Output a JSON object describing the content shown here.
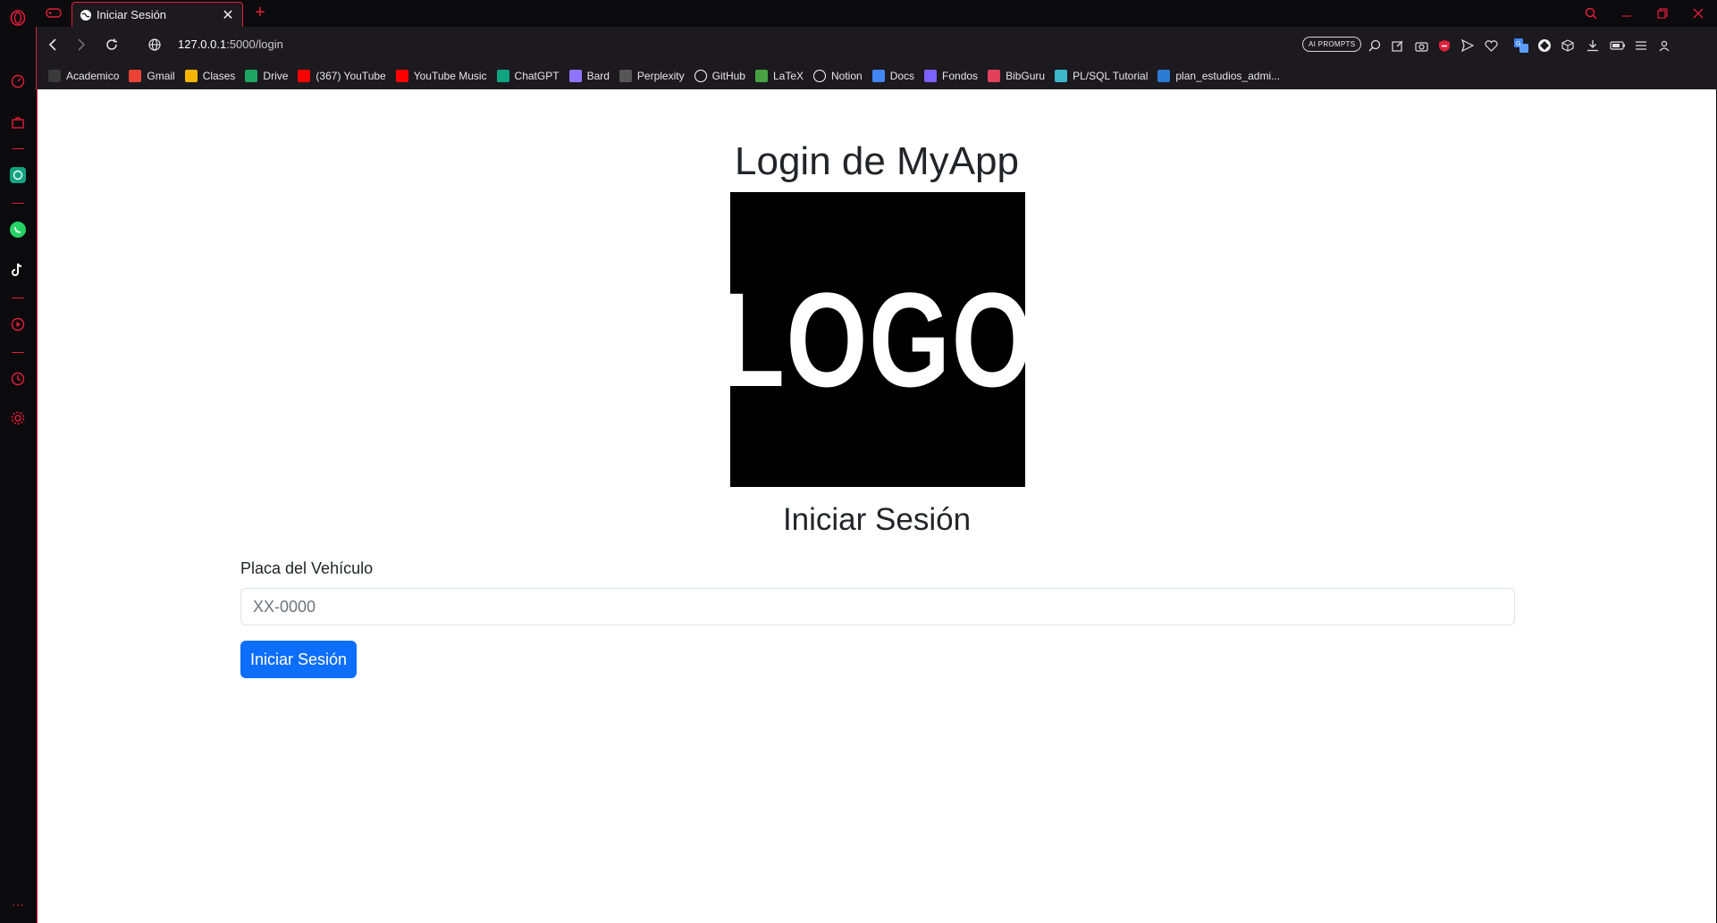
{
  "tab": {
    "title": "Iniciar Sesión",
    "new_tab": "+",
    "close": "✕"
  },
  "address": {
    "host": "127.0.0.1",
    "path": ":5000/login"
  },
  "toolbar": {
    "ai_prompts": "AI PROMPTS"
  },
  "bookmarks": [
    {
      "label": "Academico",
      "icon": "star-icon",
      "color": "#3a3a3a"
    },
    {
      "label": "Gmail",
      "icon": "gmail-icon",
      "color": "#ea4335"
    },
    {
      "label": "Clases",
      "icon": "classroom-icon",
      "color": "#f4b400"
    },
    {
      "label": "Drive",
      "icon": "drive-icon",
      "color": "#1fa463"
    },
    {
      "label": "(367) YouTube",
      "icon": "youtube-icon",
      "color": "#ff0000"
    },
    {
      "label": "YouTube Music",
      "icon": "youtube-music-icon",
      "color": "#ff0000"
    },
    {
      "label": "ChatGPT",
      "icon": "chatgpt-icon",
      "color": "#10a37f"
    },
    {
      "label": "Bard",
      "icon": "bard-icon",
      "color": "#8e75ff"
    },
    {
      "label": "Perplexity",
      "icon": "perplexity-icon",
      "color": "#555555"
    },
    {
      "label": "GitHub",
      "icon": "github-icon",
      "color": "#ffffff"
    },
    {
      "label": "LaTeX",
      "icon": "overleaf-icon",
      "color": "#47a141"
    },
    {
      "label": "Notion",
      "icon": "notion-icon",
      "color": "#ffffff"
    },
    {
      "label": "Docs",
      "icon": "docs-icon",
      "color": "#4285f4"
    },
    {
      "label": "Fondos",
      "icon": "fondos-icon",
      "color": "#7b61ff"
    },
    {
      "label": "BibGuru",
      "icon": "bibguru-icon",
      "color": "#e2405a"
    },
    {
      "label": "PL/SQL Tutorial",
      "icon": "plsql-icon",
      "color": "#3db6c9"
    },
    {
      "label": "plan_estudios_admi...",
      "icon": "plan-icon",
      "color": "#2a7bd1"
    }
  ],
  "page": {
    "title": "Login de MyApp",
    "logo_text": "LOGO",
    "subtitle": "Iniciar Sesión",
    "field_label": "Placa del Vehículo",
    "field_value": "",
    "field_placeholder": "XX-0000",
    "submit_label": "Iniciar Sesión"
  },
  "colors": {
    "accent": "#e0203a",
    "primary_button": "#0d6efd"
  }
}
